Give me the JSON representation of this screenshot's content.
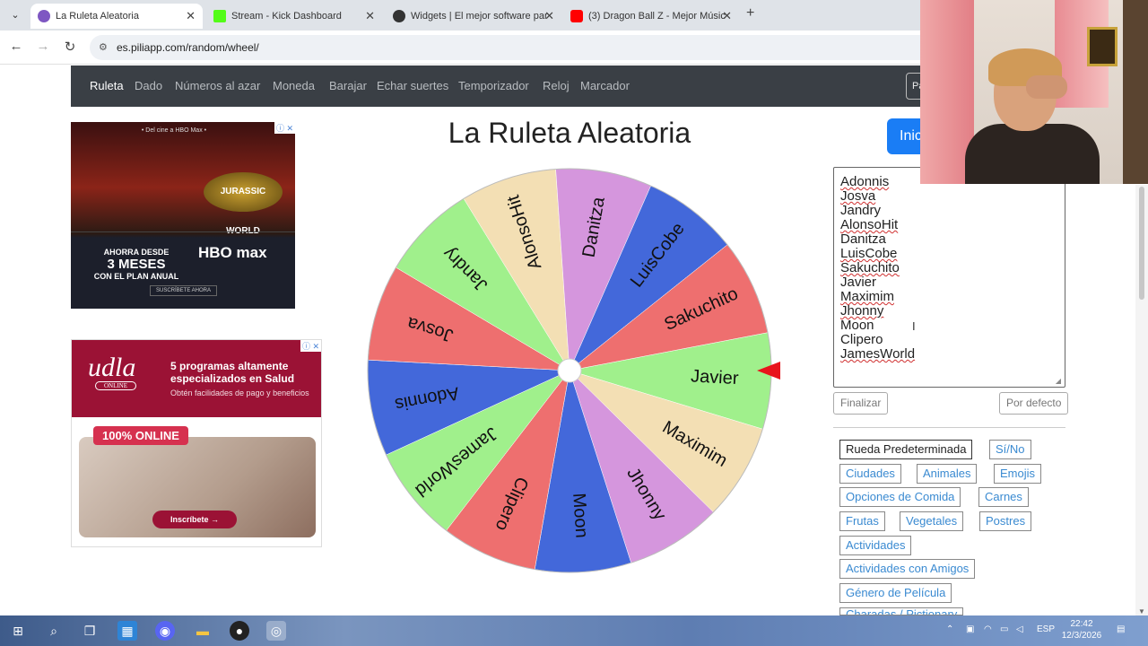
{
  "browser": {
    "tabs": [
      {
        "title": "La Ruleta Aleatoria",
        "icon_color": "#7e57c2"
      },
      {
        "title": "Stream - Kick Dashboard",
        "icon_color": "#53fc18"
      },
      {
        "title": "Widgets | El mejor software par",
        "icon_color": "#333333"
      },
      {
        "title": "(3) Dragon Ball Z - Mejor Músic",
        "icon_color": "#ff0000"
      }
    ],
    "url": "es.piliapp.com/random/wheel/"
  },
  "sitenav": {
    "items": [
      "Ruleta",
      "Dado",
      "Números al azar",
      "Moneda",
      "Barajar",
      "Echar suertes",
      "Temporizador",
      "Reloj",
      "Marcador"
    ],
    "right_button": "Pa"
  },
  "ad1": {
    "top": "• Del cine a HBO Max •",
    "logo": "JURASSIC WORLD",
    "line1": "AHORRA DESDE",
    "line2": "3 MESES",
    "line3": "CON EL PLAN ANUAL",
    "brand": "HBO max",
    "cta": "SUSCRÍBETE AHORA"
  },
  "ad2": {
    "logo": "udla",
    "logo_sub": "ONLINE",
    "headline": "5 programas altamente especializados en Salud",
    "sub": "Obtén facilidades de pago y beneficios",
    "badge": "100% ONLINE",
    "cta": "Inscríbete →"
  },
  "page": {
    "title": "La Ruleta Aleatoria",
    "start_button": "Inic"
  },
  "wheel": {
    "segments": [
      {
        "name": "Javier",
        "color": "#a0f08c"
      },
      {
        "name": "Maximim",
        "color": "#f3dfb4"
      },
      {
        "name": "Jhonny",
        "color": "#d596dd"
      },
      {
        "name": "Moon",
        "color": "#4368da"
      },
      {
        "name": "Clipero",
        "color": "#ee6f6f"
      },
      {
        "name": "JamesWorld",
        "color": "#a0f08c"
      },
      {
        "name": "Adonnis",
        "color": "#4368da"
      },
      {
        "name": "Josva",
        "color": "#ee6f6f"
      },
      {
        "name": "Jandry",
        "color": "#a0f08c"
      },
      {
        "name": "AlonsoHit",
        "color": "#f3dfb4"
      },
      {
        "name": "Danitza",
        "color": "#d596dd"
      },
      {
        "name": "LuisCobe",
        "color": "#4368da"
      },
      {
        "name": "Sakuchito",
        "color": "#ee6f6f"
      }
    ],
    "pointer_color": "#e8141c"
  },
  "names": [
    "Adonnis",
    "Josva",
    "Jandry",
    "AlonsoHit",
    "Danitza",
    "LuisCobe",
    "Sakuchito",
    "Javier",
    "Maximim",
    "Jhonny",
    "Moon",
    "Clipero",
    "JamesWorld"
  ],
  "buttons": {
    "finish": "Finalizar",
    "default": "Por defecto"
  },
  "presets": [
    "Rueda Predeterminada",
    "Sí/No",
    "Ciudades",
    "Animales",
    "Emojis",
    "Opciones de Comida",
    "Carnes",
    "Frutas",
    "Vegetales",
    "Postres",
    "Actividades",
    "Actividades con Amigos",
    "Género de Película",
    "Charadas / Pictionary"
  ],
  "taskbar": {
    "lang": "ESP",
    "time": "22:42",
    "date": "12/3/2026"
  }
}
